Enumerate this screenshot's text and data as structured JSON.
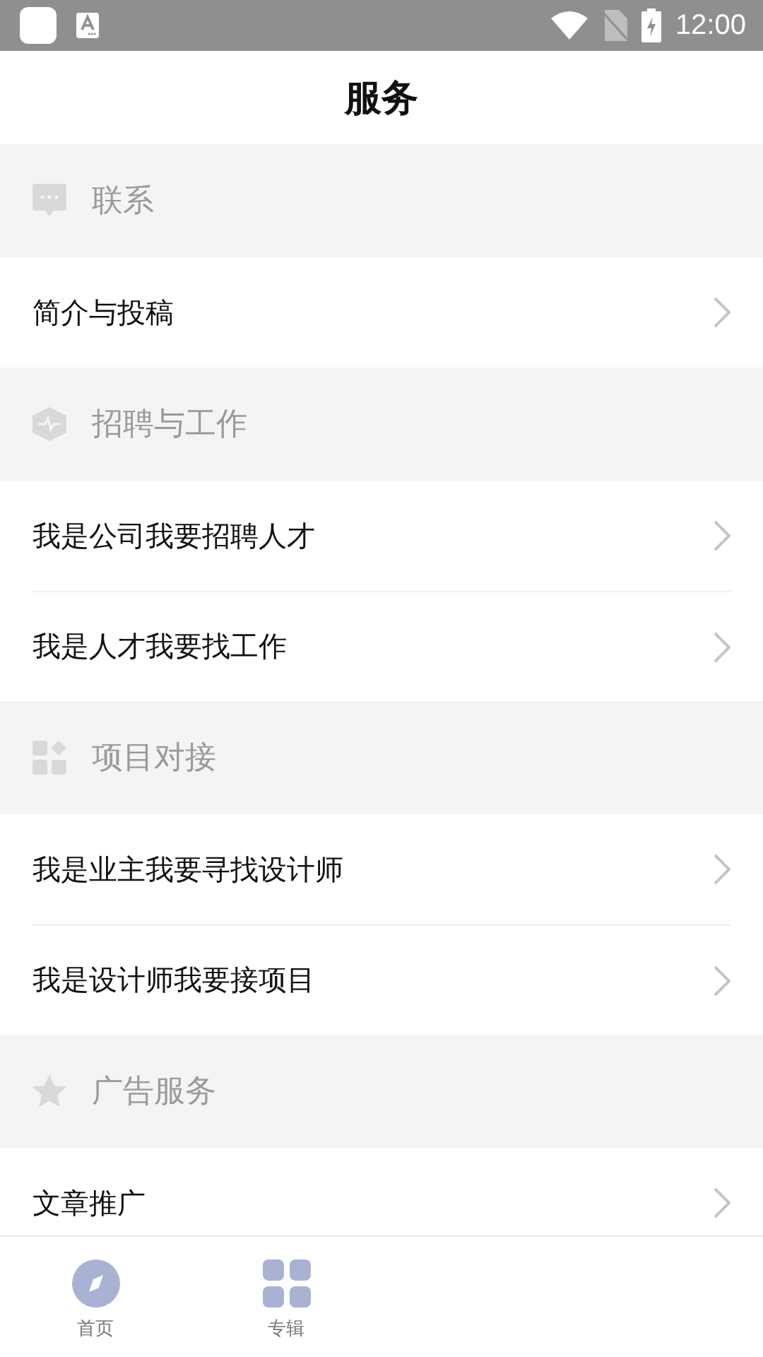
{
  "status_bar": {
    "time": "12:00"
  },
  "header": {
    "title": "服务"
  },
  "sections": [
    {
      "title": "联系",
      "items": [
        {
          "label": "简介与投稿"
        }
      ]
    },
    {
      "title": "招聘与工作",
      "items": [
        {
          "label": "我是公司我要招聘人才"
        },
        {
          "label": "我是人才我要找工作"
        }
      ]
    },
    {
      "title": "项目对接",
      "items": [
        {
          "label": "我是业主我要寻找设计师"
        },
        {
          "label": "我是设计师我要接项目"
        }
      ]
    },
    {
      "title": "广告服务",
      "items": [
        {
          "label": "文章推广"
        }
      ]
    }
  ],
  "bottom_nav": [
    {
      "label": "首页"
    },
    {
      "label": "专辑"
    }
  ]
}
